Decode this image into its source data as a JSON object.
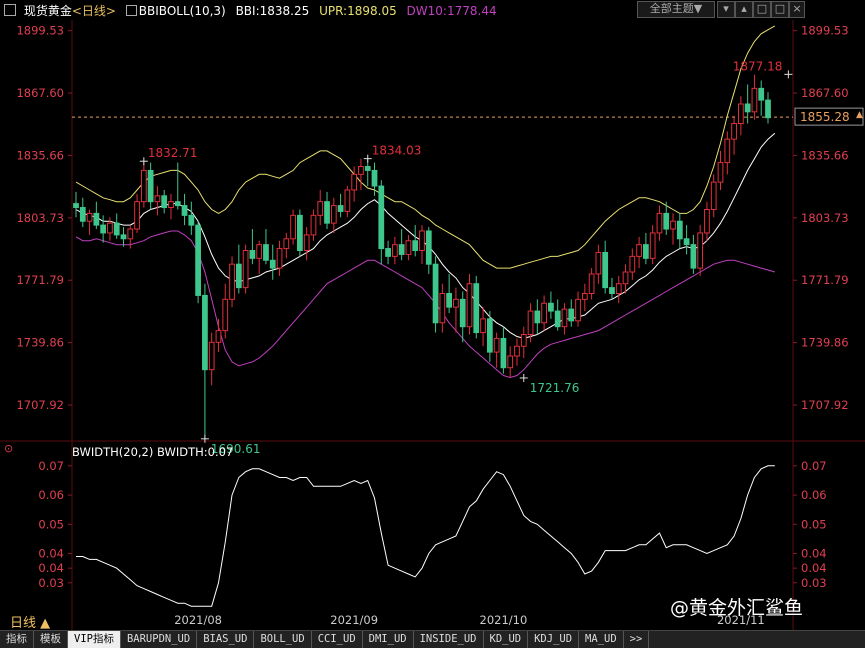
{
  "header": {
    "symbol": "现货黄金",
    "period_label": "<日线>",
    "indicator": "BBIBOLL(10,3)",
    "bbi": "BBI:1838.25",
    "upr": "UPR:1898.05",
    "dw": "DW10:1778.44",
    "theme_button": "全部主题▼"
  },
  "lower_panel": {
    "title": "BWIDTH(20,2) BWIDTH:0.07"
  },
  "period_button": "日线 ▲",
  "watermark": "@黄金外汇鲨鱼",
  "tabs": [
    "指标",
    "模板",
    "VIP指标",
    "BARUPDN_UD",
    "BIAS_UD",
    "BOLL_UD",
    "CCI_UD",
    "DMI_UD",
    "INSIDE_UD",
    "KD_UD",
    "KDJ_UD",
    "MA_UD",
    ">>"
  ],
  "active_tab": 2,
  "colors": {
    "up": "#e0303a",
    "down": "#3ec78c",
    "bbi": "#ffffff",
    "upr": "#e8e070",
    "dw": "#c040c0",
    "axis_text": "#e04050",
    "last_price": "#e8a060"
  },
  "chart_data": {
    "type": "candlestick",
    "price_axis_labels": [
      "1899.53",
      "1867.60",
      "1835.66",
      "1803.73",
      "1771.79",
      "1739.86",
      "1707.92"
    ],
    "price_range": [
      1690,
      1905
    ],
    "last_price": "1855.28",
    "annotations": [
      {
        "text": "1832.71",
        "index": 10,
        "value": 1832.71,
        "kind": "high"
      },
      {
        "text": "1834.03",
        "index": 43,
        "value": 1834.03,
        "kind": "high"
      },
      {
        "text": "1877.18",
        "index": 105,
        "value": 1877.18,
        "kind": "high"
      },
      {
        "text": "1690.61",
        "index": 19,
        "value": 1690.61,
        "kind": "low"
      },
      {
        "text": "1721.76",
        "index": 66,
        "value": 1721.76,
        "kind": "low"
      }
    ],
    "x_labels": [
      {
        "text": "2021/08",
        "index": 18
      },
      {
        "text": "2021/09",
        "index": 41
      },
      {
        "text": "2021/10",
        "index": 63
      },
      {
        "text": "2021/11",
        "index": 98
      }
    ],
    "candles": [
      [
        1811,
        1817,
        1804,
        1809
      ],
      [
        1809,
        1814,
        1799,
        1802
      ],
      [
        1802,
        1808,
        1795,
        1806
      ],
      [
        1806,
        1812,
        1798,
        1800
      ],
      [
        1800,
        1805,
        1791,
        1796
      ],
      [
        1796,
        1804,
        1792,
        1801
      ],
      [
        1801,
        1806,
        1793,
        1795
      ],
      [
        1795,
        1799,
        1789,
        1793
      ],
      [
        1793,
        1800,
        1788,
        1798
      ],
      [
        1798,
        1816,
        1796,
        1812
      ],
      [
        1812,
        1833,
        1809,
        1828
      ],
      [
        1828,
        1832,
        1808,
        1812
      ],
      [
        1812,
        1820,
        1805,
        1815
      ],
      [
        1815,
        1818,
        1806,
        1809
      ],
      [
        1809,
        1816,
        1803,
        1812
      ],
      [
        1812,
        1832,
        1808,
        1810
      ],
      [
        1810,
        1816,
        1800,
        1805
      ],
      [
        1805,
        1812,
        1795,
        1800
      ],
      [
        1800,
        1802,
        1760,
        1764
      ],
      [
        1764,
        1770,
        1690,
        1726
      ],
      [
        1726,
        1745,
        1718,
        1740
      ],
      [
        1740,
        1752,
        1735,
        1746
      ],
      [
        1746,
        1770,
        1742,
        1762
      ],
      [
        1762,
        1784,
        1758,
        1780
      ],
      [
        1780,
        1790,
        1765,
        1768
      ],
      [
        1768,
        1790,
        1765,
        1787
      ],
      [
        1787,
        1798,
        1780,
        1783
      ],
      [
        1783,
        1792,
        1775,
        1790
      ],
      [
        1790,
        1798,
        1780,
        1782
      ],
      [
        1782,
        1790,
        1772,
        1778
      ],
      [
        1778,
        1792,
        1774,
        1788
      ],
      [
        1788,
        1796,
        1783,
        1793
      ],
      [
        1793,
        1808,
        1790,
        1805
      ],
      [
        1805,
        1808,
        1784,
        1787
      ],
      [
        1787,
        1799,
        1782,
        1795
      ],
      [
        1795,
        1808,
        1792,
        1805
      ],
      [
        1805,
        1818,
        1800,
        1812
      ],
      [
        1812,
        1817,
        1798,
        1801
      ],
      [
        1801,
        1814,
        1796,
        1810
      ],
      [
        1810,
        1816,
        1804,
        1807
      ],
      [
        1807,
        1820,
        1804,
        1818
      ],
      [
        1818,
        1830,
        1812,
        1826
      ],
      [
        1826,
        1834,
        1818,
        1830
      ],
      [
        1830,
        1834,
        1820,
        1828
      ],
      [
        1828,
        1832,
        1815,
        1820
      ],
      [
        1820,
        1823,
        1780,
        1788
      ],
      [
        1788,
        1792,
        1780,
        1784
      ],
      [
        1784,
        1794,
        1780,
        1790
      ],
      [
        1790,
        1798,
        1782,
        1785
      ],
      [
        1785,
        1795,
        1782,
        1792
      ],
      [
        1792,
        1800,
        1784,
        1787
      ],
      [
        1787,
        1800,
        1780,
        1797
      ],
      [
        1797,
        1799,
        1775,
        1780
      ],
      [
        1780,
        1784,
        1745,
        1750
      ],
      [
        1750,
        1770,
        1745,
        1765
      ],
      [
        1765,
        1775,
        1755,
        1758
      ],
      [
        1758,
        1768,
        1745,
        1762
      ],
      [
        1762,
        1766,
        1740,
        1748
      ],
      [
        1748,
        1775,
        1744,
        1770
      ],
      [
        1770,
        1774,
        1742,
        1745
      ],
      [
        1745,
        1758,
        1738,
        1752
      ],
      [
        1752,
        1756,
        1730,
        1735
      ],
      [
        1735,
        1745,
        1727,
        1742
      ],
      [
        1742,
        1748,
        1724,
        1727
      ],
      [
        1727,
        1738,
        1722,
        1733
      ],
      [
        1733,
        1742,
        1728,
        1738
      ],
      [
        1738,
        1748,
        1732,
        1744
      ],
      [
        1744,
        1760,
        1740,
        1756
      ],
      [
        1756,
        1762,
        1744,
        1750
      ],
      [
        1750,
        1764,
        1746,
        1760
      ],
      [
        1760,
        1766,
        1752,
        1756
      ],
      [
        1756,
        1762,
        1746,
        1748
      ],
      [
        1748,
        1760,
        1744,
        1757
      ],
      [
        1757,
        1762,
        1748,
        1751
      ],
      [
        1751,
        1766,
        1748,
        1762
      ],
      [
        1762,
        1770,
        1756,
        1765
      ],
      [
        1765,
        1778,
        1762,
        1775
      ],
      [
        1775,
        1790,
        1770,
        1786
      ],
      [
        1786,
        1792,
        1765,
        1768
      ],
      [
        1768,
        1773,
        1762,
        1765
      ],
      [
        1765,
        1774,
        1760,
        1770
      ],
      [
        1770,
        1780,
        1765,
        1776
      ],
      [
        1776,
        1788,
        1772,
        1784
      ],
      [
        1784,
        1794,
        1778,
        1790
      ],
      [
        1790,
        1796,
        1780,
        1783
      ],
      [
        1783,
        1800,
        1780,
        1796
      ],
      [
        1796,
        1810,
        1792,
        1806
      ],
      [
        1806,
        1812,
        1795,
        1798
      ],
      [
        1798,
        1806,
        1790,
        1802
      ],
      [
        1802,
        1806,
        1788,
        1793
      ],
      [
        1793,
        1800,
        1785,
        1790
      ],
      [
        1790,
        1795,
        1775,
        1778
      ],
      [
        1778,
        1800,
        1774,
        1796
      ],
      [
        1796,
        1812,
        1792,
        1808
      ],
      [
        1808,
        1826,
        1804,
        1822
      ],
      [
        1822,
        1838,
        1818,
        1832
      ],
      [
        1832,
        1848,
        1826,
        1844
      ],
      [
        1844,
        1856,
        1836,
        1852
      ],
      [
        1852,
        1866,
        1846,
        1862
      ],
      [
        1862,
        1872,
        1852,
        1858
      ],
      [
        1858,
        1877,
        1854,
        1870
      ],
      [
        1870,
        1874,
        1856,
        1864
      ],
      [
        1864,
        1868,
        1852,
        1855
      ]
    ],
    "bbi": [
      1808,
      1806,
      1805,
      1804,
      1802,
      1802,
      1801,
      1800,
      1800,
      1802,
      1806,
      1808,
      1809,
      1810,
      1811,
      1811,
      1809,
      1807,
      1802,
      1794,
      1785,
      1778,
      1774,
      1772,
      1771,
      1772,
      1773,
      1774,
      1776,
      1777,
      1778,
      1780,
      1782,
      1784,
      1786,
      1788,
      1792,
      1795,
      1797,
      1799,
      1801,
      1804,
      1808,
      1811,
      1813,
      1810,
      1806,
      1803,
      1800,
      1797,
      1794,
      1792,
      1789,
      1785,
      1780,
      1776,
      1773,
      1768,
      1765,
      1761,
      1757,
      1753,
      1750,
      1748,
      1745,
      1743,
      1742,
      1743,
      1744,
      1746,
      1748,
      1750,
      1752,
      1752,
      1753,
      1754,
      1757,
      1760,
      1761,
      1762,
      1764,
      1766,
      1769,
      1772,
      1774,
      1777,
      1781,
      1784,
      1786,
      1788,
      1789,
      1788,
      1789,
      1792,
      1796,
      1801,
      1807,
      1814,
      1821,
      1828,
      1834,
      1840,
      1844,
      1847
    ],
    "upr": [
      1822,
      1820,
      1818,
      1816,
      1814,
      1813,
      1812,
      1812,
      1814,
      1818,
      1822,
      1825,
      1826,
      1827,
      1828,
      1828,
      1826,
      1822,
      1818,
      1812,
      1808,
      1806,
      1808,
      1812,
      1818,
      1822,
      1824,
      1826,
      1826,
      1825,
      1824,
      1826,
      1828,
      1832,
      1834,
      1836,
      1838,
      1838,
      1836,
      1834,
      1830,
      1826,
      1822,
      1819,
      1818,
      1816,
      1814,
      1812,
      1812,
      1810,
      1808,
      1805,
      1803,
      1800,
      1798,
      1796,
      1794,
      1792,
      1790,
      1786,
      1782,
      1780,
      1778,
      1778,
      1778,
      1779,
      1780,
      1781,
      1782,
      1783,
      1784,
      1784,
      1785,
      1786,
      1787,
      1790,
      1794,
      1798,
      1802,
      1805,
      1808,
      1810,
      1812,
      1814,
      1814,
      1813,
      1812,
      1810,
      1808,
      1806,
      1806,
      1808,
      1812,
      1820,
      1830,
      1842,
      1856,
      1868,
      1880,
      1888,
      1894,
      1898,
      1900,
      1902
    ],
    "dw": [
      1794,
      1792,
      1792,
      1793,
      1792,
      1791,
      1790,
      1790,
      1790,
      1791,
      1792,
      1794,
      1795,
      1796,
      1797,
      1797,
      1795,
      1792,
      1786,
      1776,
      1762,
      1748,
      1736,
      1730,
      1728,
      1729,
      1730,
      1732,
      1735,
      1738,
      1742,
      1746,
      1750,
      1754,
      1758,
      1762,
      1766,
      1770,
      1772,
      1774,
      1776,
      1778,
      1780,
      1782,
      1782,
      1780,
      1778,
      1776,
      1774,
      1772,
      1770,
      1768,
      1764,
      1760,
      1755,
      1750,
      1746,
      1742,
      1738,
      1735,
      1732,
      1729,
      1726,
      1723,
      1722,
      1723,
      1726,
      1730,
      1734,
      1737,
      1739,
      1740,
      1741,
      1742,
      1743,
      1744,
      1745,
      1746,
      1748,
      1750,
      1752,
      1754,
      1756,
      1758,
      1760,
      1762,
      1764,
      1766,
      1768,
      1770,
      1772,
      1774,
      1776,
      1778,
      1780,
      1781,
      1782,
      1782,
      1781,
      1780,
      1779,
      1778,
      1777,
      1776
    ],
    "bwidth_axis_labels": [
      "0.07",
      "0.06",
      "0.05",
      "0.04",
      "0.04",
      "0.03"
    ],
    "bwidth_range": [
      0.02,
      0.072
    ],
    "bwidth": [
      0.039,
      0.039,
      0.038,
      0.038,
      0.037,
      0.036,
      0.035,
      0.033,
      0.031,
      0.029,
      0.028,
      0.027,
      0.026,
      0.025,
      0.024,
      0.023,
      0.023,
      0.022,
      0.022,
      0.022,
      0.022,
      0.03,
      0.044,
      0.06,
      0.066,
      0.068,
      0.069,
      0.069,
      0.068,
      0.067,
      0.066,
      0.066,
      0.065,
      0.066,
      0.066,
      0.063,
      0.063,
      0.063,
      0.063,
      0.063,
      0.064,
      0.065,
      0.064,
      0.065,
      0.059,
      0.047,
      0.036,
      0.035,
      0.034,
      0.033,
      0.032,
      0.035,
      0.04,
      0.043,
      0.044,
      0.045,
      0.046,
      0.051,
      0.056,
      0.058,
      0.062,
      0.065,
      0.068,
      0.067,
      0.063,
      0.058,
      0.053,
      0.051,
      0.05,
      0.048,
      0.046,
      0.044,
      0.042,
      0.04,
      0.037,
      0.033,
      0.034,
      0.037,
      0.041,
      0.041,
      0.041,
      0.041,
      0.042,
      0.043,
      0.043,
      0.045,
      0.047,
      0.042,
      0.043,
      0.043,
      0.043,
      0.042,
      0.041,
      0.04,
      0.041,
      0.042,
      0.043,
      0.046,
      0.052,
      0.06,
      0.066,
      0.069,
      0.07,
      0.07
    ]
  }
}
